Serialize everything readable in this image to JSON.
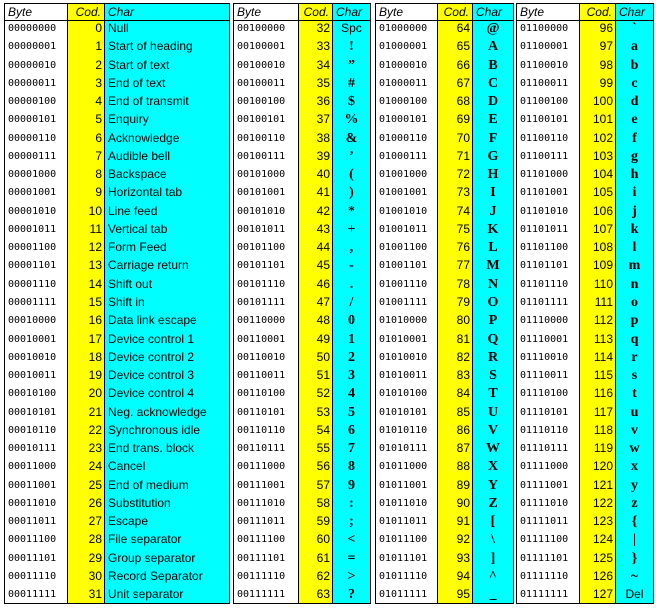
{
  "headers": {
    "byte": "Byte",
    "code": "Cod.",
    "char": "Char"
  },
  "colors": {
    "code_column": "#ffff00",
    "char_column": "#00ffff"
  },
  "panels": [
    {
      "rows": [
        [
          "00000000",
          "0",
          "Null"
        ],
        [
          "00000001",
          "1",
          "Start of heading"
        ],
        [
          "00000010",
          "2",
          "Start of text"
        ],
        [
          "00000011",
          "3",
          "End of text"
        ],
        [
          "00000100",
          "4",
          "End of transmit"
        ],
        [
          "00000101",
          "5",
          "Enquiry"
        ],
        [
          "00000110",
          "6",
          "Acknowledge"
        ],
        [
          "00000111",
          "7",
          "Audible bell"
        ],
        [
          "00001000",
          "8",
          "Backspace"
        ],
        [
          "00001001",
          "9",
          "Horizontal tab"
        ],
        [
          "00001010",
          "10",
          "Line feed"
        ],
        [
          "00001011",
          "11",
          "Vertical tab"
        ],
        [
          "00001100",
          "12",
          "Form Feed"
        ],
        [
          "00001101",
          "13",
          "Carriage return"
        ],
        [
          "00001110",
          "14",
          "Shift out"
        ],
        [
          "00001111",
          "15",
          "Shift in"
        ],
        [
          "00010000",
          "16",
          "Data link escape"
        ],
        [
          "00010001",
          "17",
          "Device control 1"
        ],
        [
          "00010010",
          "18",
          "Device control 2"
        ],
        [
          "00010011",
          "19",
          "Device control 3"
        ],
        [
          "00010100",
          "20",
          "Device control 4"
        ],
        [
          "00010101",
          "21",
          "Neg. acknowledge"
        ],
        [
          "00010110",
          "22",
          "Synchronous idle"
        ],
        [
          "00010111",
          "23",
          "End trans. block"
        ],
        [
          "00011000",
          "24",
          "Cancel"
        ],
        [
          "00011001",
          "25",
          "End of medium"
        ],
        [
          "00011010",
          "26",
          "Substitution"
        ],
        [
          "00011011",
          "27",
          "Escape"
        ],
        [
          "00011100",
          "28",
          "File separator"
        ],
        [
          "00011101",
          "29",
          "Group separator"
        ],
        [
          "00011110",
          "30",
          "Record Separator"
        ],
        [
          "00011111",
          "31",
          "Unit separator"
        ]
      ]
    },
    {
      "rows": [
        [
          "00100000",
          "32",
          "Spc"
        ],
        [
          "00100001",
          "33",
          "!"
        ],
        [
          "00100010",
          "34",
          "”"
        ],
        [
          "00100011",
          "35",
          "#"
        ],
        [
          "00100100",
          "36",
          "$"
        ],
        [
          "00100101",
          "37",
          "%"
        ],
        [
          "00100110",
          "38",
          "&"
        ],
        [
          "00100111",
          "39",
          "’"
        ],
        [
          "00101000",
          "40",
          "("
        ],
        [
          "00101001",
          "41",
          ")"
        ],
        [
          "00101010",
          "42",
          "*"
        ],
        [
          "00101011",
          "43",
          "+"
        ],
        [
          "00101100",
          "44",
          ","
        ],
        [
          "00101101",
          "45",
          "-"
        ],
        [
          "00101110",
          "46",
          "."
        ],
        [
          "00101111",
          "47",
          "/"
        ],
        [
          "00110000",
          "48",
          "0"
        ],
        [
          "00110001",
          "49",
          "1"
        ],
        [
          "00110010",
          "50",
          "2"
        ],
        [
          "00110011",
          "51",
          "3"
        ],
        [
          "00110100",
          "52",
          "4"
        ],
        [
          "00110101",
          "53",
          "5"
        ],
        [
          "00110110",
          "54",
          "6"
        ],
        [
          "00110111",
          "55",
          "7"
        ],
        [
          "00111000",
          "56",
          "8"
        ],
        [
          "00111001",
          "57",
          "9"
        ],
        [
          "00111010",
          "58",
          ":"
        ],
        [
          "00111011",
          "59",
          ";"
        ],
        [
          "00111100",
          "60",
          "<"
        ],
        [
          "00111101",
          "61",
          "="
        ],
        [
          "00111110",
          "62",
          ">"
        ],
        [
          "00111111",
          "63",
          "?"
        ]
      ]
    },
    {
      "rows": [
        [
          "01000000",
          "64",
          "@"
        ],
        [
          "01000001",
          "65",
          "A"
        ],
        [
          "01000010",
          "66",
          "B"
        ],
        [
          "01000011",
          "67",
          "C"
        ],
        [
          "01000100",
          "68",
          "D"
        ],
        [
          "01000101",
          "69",
          "E"
        ],
        [
          "01000110",
          "70",
          "F"
        ],
        [
          "01000111",
          "71",
          "G"
        ],
        [
          "01001000",
          "72",
          "H"
        ],
        [
          "01001001",
          "73",
          "I"
        ],
        [
          "01001010",
          "74",
          "J"
        ],
        [
          "01001011",
          "75",
          "K"
        ],
        [
          "01001100",
          "76",
          "L"
        ],
        [
          "01001101",
          "77",
          "M"
        ],
        [
          "01001110",
          "78",
          "N"
        ],
        [
          "01001111",
          "79",
          "O"
        ],
        [
          "01010000",
          "80",
          "P"
        ],
        [
          "01010001",
          "81",
          "Q"
        ],
        [
          "01010010",
          "82",
          "R"
        ],
        [
          "01010011",
          "83",
          "S"
        ],
        [
          "01010100",
          "84",
          "T"
        ],
        [
          "01010101",
          "85",
          "U"
        ],
        [
          "01010110",
          "86",
          "V"
        ],
        [
          "01010111",
          "87",
          "W"
        ],
        [
          "01011000",
          "88",
          "X"
        ],
        [
          "01011001",
          "89",
          "Y"
        ],
        [
          "01011010",
          "90",
          "Z"
        ],
        [
          "01011011",
          "91",
          "["
        ],
        [
          "01011100",
          "92",
          "\\"
        ],
        [
          "01011101",
          "93",
          "]"
        ],
        [
          "01011110",
          "94",
          "^"
        ],
        [
          "01011111",
          "95",
          "_"
        ]
      ]
    },
    {
      "rows": [
        [
          "01100000",
          "96",
          "`"
        ],
        [
          "01100001",
          "97",
          "a"
        ],
        [
          "01100010",
          "98",
          "b"
        ],
        [
          "01100011",
          "99",
          "c"
        ],
        [
          "01100100",
          "100",
          "d"
        ],
        [
          "01100101",
          "101",
          "e"
        ],
        [
          "01100110",
          "102",
          "f"
        ],
        [
          "01100111",
          "103",
          "g"
        ],
        [
          "01101000",
          "104",
          "h"
        ],
        [
          "01101001",
          "105",
          "i"
        ],
        [
          "01101010",
          "106",
          "j"
        ],
        [
          "01101011",
          "107",
          "k"
        ],
        [
          "01101100",
          "108",
          "l"
        ],
        [
          "01101101",
          "109",
          "m"
        ],
        [
          "01101110",
          "110",
          "n"
        ],
        [
          "01101111",
          "111",
          "o"
        ],
        [
          "01110000",
          "112",
          "p"
        ],
        [
          "01110001",
          "113",
          "q"
        ],
        [
          "01110010",
          "114",
          "r"
        ],
        [
          "01110011",
          "115",
          "s"
        ],
        [
          "01110100",
          "116",
          "t"
        ],
        [
          "01110101",
          "117",
          "u"
        ],
        [
          "01110110",
          "118",
          "v"
        ],
        [
          "01110111",
          "119",
          "w"
        ],
        [
          "01111000",
          "120",
          "x"
        ],
        [
          "01111001",
          "121",
          "y"
        ],
        [
          "01111010",
          "122",
          "z"
        ],
        [
          "01111011",
          "123",
          "{"
        ],
        [
          "01111100",
          "124",
          "|"
        ],
        [
          "01111101",
          "125",
          "}"
        ],
        [
          "01111110",
          "126",
          "~"
        ],
        [
          "01111111",
          "127",
          "Del"
        ]
      ]
    }
  ]
}
